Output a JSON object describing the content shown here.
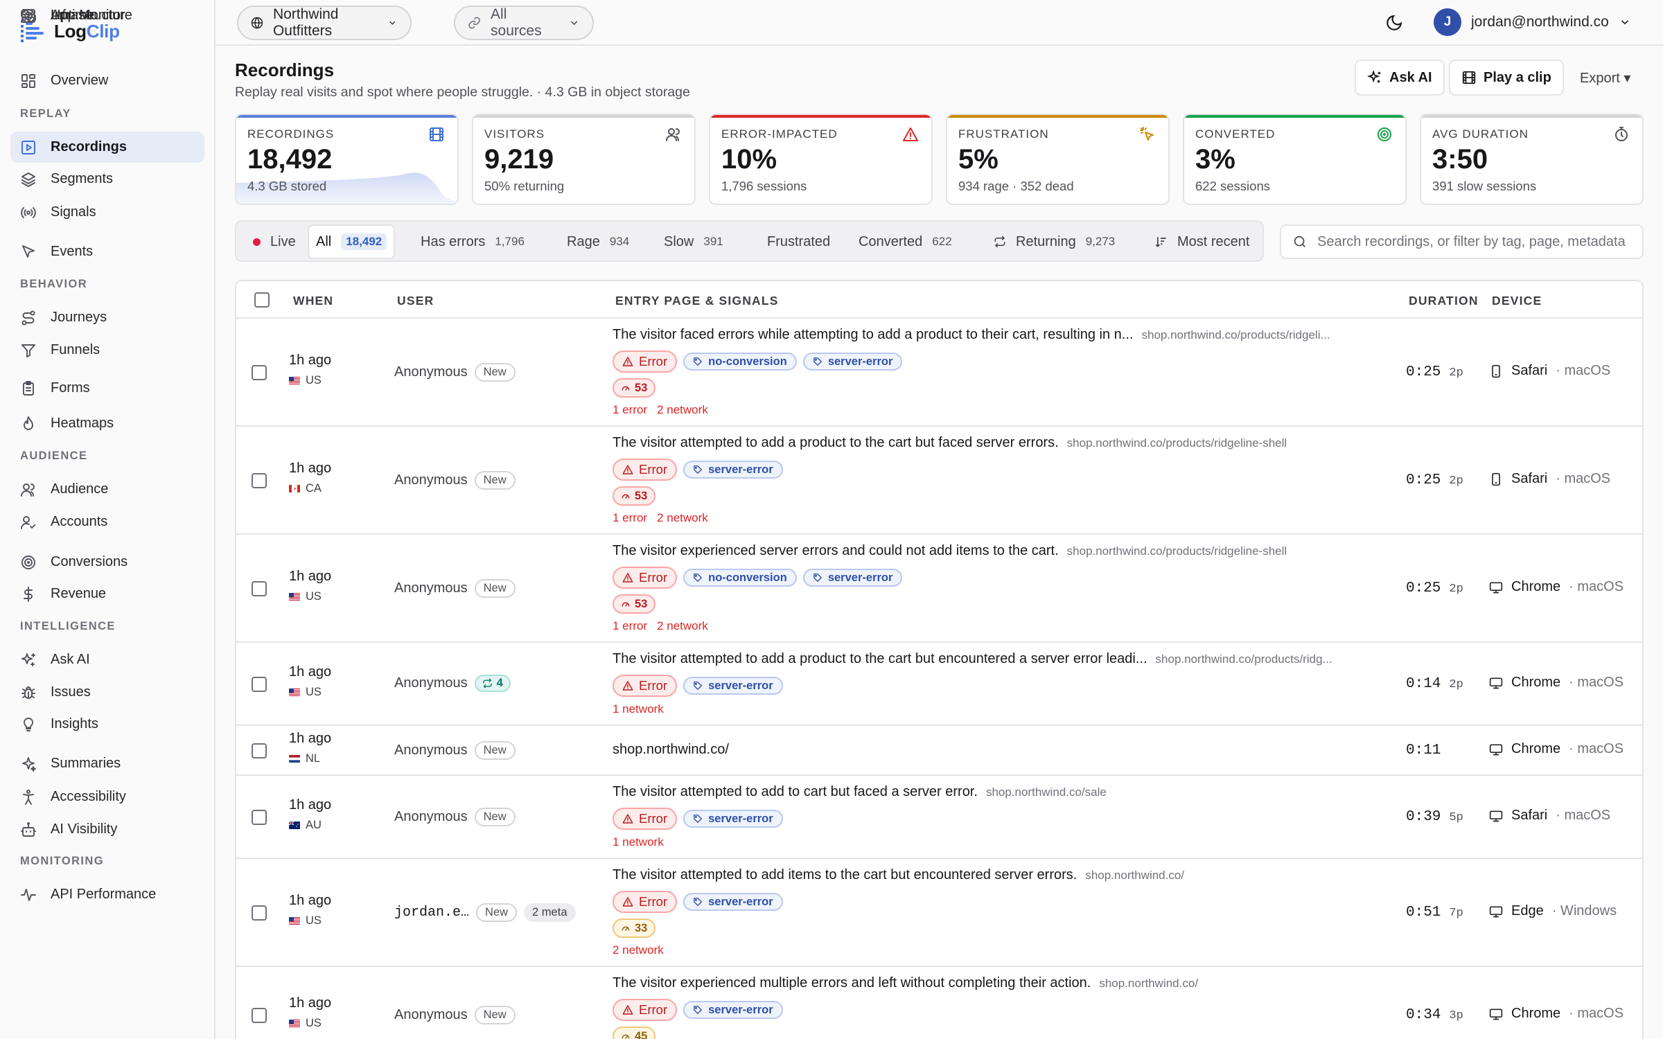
{
  "brand": {
    "name_a": "Log",
    "name_b": "Clip"
  },
  "colors": {
    "accent": "#3b6fd4",
    "error": "#dc2626",
    "success": "#16a34a",
    "warning": "#ca8a04"
  },
  "sidebar": {
    "top": [
      {
        "label": "Overview",
        "icon": "grid-icon"
      }
    ],
    "sections": [
      {
        "title": "REPLAY",
        "items": [
          {
            "label": "Recordings",
            "icon": "play-square-icon",
            "active": true
          },
          {
            "label": "Segments",
            "icon": "layers-icon"
          },
          {
            "label": "Signals",
            "icon": "broadcast-icon"
          },
          {
            "label": "Events",
            "icon": "cursor-icon"
          }
        ]
      },
      {
        "title": "BEHAVIOR",
        "items": [
          {
            "label": "Journeys",
            "icon": "route-icon"
          },
          {
            "label": "Funnels",
            "icon": "funnel-icon"
          },
          {
            "label": "Forms",
            "icon": "clipboard-icon"
          },
          {
            "label": "Heatmaps",
            "icon": "flame-icon"
          }
        ]
      },
      {
        "title": "AUDIENCE",
        "items": [
          {
            "label": "Audience",
            "icon": "users-icon"
          },
          {
            "label": "Accounts",
            "icon": "user-check-icon"
          },
          {
            "label": "Conversions",
            "icon": "target-icon"
          },
          {
            "label": "Revenue",
            "icon": "dollar-icon"
          }
        ]
      },
      {
        "title": "INTELLIGENCE",
        "items": [
          {
            "label": "Ask AI",
            "icon": "sparkles-icon"
          },
          {
            "label": "Issues",
            "icon": "bug-icon"
          },
          {
            "label": "Insights",
            "icon": "lightbulb-icon"
          },
          {
            "label": "Summaries",
            "icon": "sparkle-icon"
          },
          {
            "label": "Accessibility",
            "icon": "accessibility-icon"
          },
          {
            "label": "AI Visibility",
            "icon": "bot-icon"
          }
        ]
      },
      {
        "title": "MONITORING",
        "items": [
          {
            "label": "API Performance",
            "icon": "activity-icon"
          },
          {
            "label": "App Monitor",
            "icon": "boxes-icon"
          },
          {
            "label": "Uptime",
            "icon": "radar-icon"
          },
          {
            "label": "Infrastructure",
            "icon": "server-icon"
          }
        ]
      }
    ]
  },
  "topbar": {
    "workspace": "Northwind Outfitters",
    "sources": "All sources",
    "user_initial": "J",
    "user_email": "jordan@northwind.co"
  },
  "page": {
    "title": "Recordings",
    "subtitle": "Replay real visits and spot where people struggle. · 4.3 GB in object storage",
    "ask_ai": "Ask AI",
    "play_clip": "Play a clip",
    "export": "Export ▾"
  },
  "stats": [
    {
      "label": "RECORDINGS",
      "value": "18,492",
      "sub": "4.3 GB stored",
      "icon": "film-icon",
      "color": "#5b7fd9"
    },
    {
      "label": "VISITORS",
      "value": "9,219",
      "sub": "50% returning",
      "icon": "users-icon",
      "color": "#d4d4d8"
    },
    {
      "label": "ERROR-IMPACTED",
      "value": "10%",
      "sub": "1,796 sessions",
      "icon": "alert-triangle-icon",
      "color": "#dc2626"
    },
    {
      "label": "FRUSTRATION",
      "value": "5%",
      "sub": "934 rage · 352 dead",
      "icon": "click-burst-icon",
      "color": "#ca8a04"
    },
    {
      "label": "CONVERTED",
      "value": "3%",
      "sub": "622 sessions",
      "icon": "target-icon",
      "color": "#16a34a"
    },
    {
      "label": "AVG DURATION",
      "value": "3:50",
      "sub": "391 slow sessions",
      "icon": "timer-icon",
      "color": "#d4d4d8"
    }
  ],
  "filters": {
    "live": "Live",
    "items": [
      {
        "label": "All",
        "count": "18,492",
        "active": true
      },
      {
        "label": "Has errors",
        "count": "1,796"
      },
      {
        "label": "Rage",
        "count": "934"
      },
      {
        "label": "Slow",
        "count": "391"
      },
      {
        "label": "Frustrated",
        "count": ""
      },
      {
        "label": "Converted",
        "count": "622"
      },
      {
        "label": "Returning",
        "count": "9,273"
      }
    ],
    "sort": "Most recent",
    "search_placeholder": "Search recordings, or filter by tag, page, metadata"
  },
  "table": {
    "columns": {
      "when": "WHEN",
      "user": "USER",
      "entry": "ENTRY PAGE & SIGNALS",
      "duration": "DURATION",
      "device": "DEVICE"
    },
    "rows": [
      {
        "when": "1h ago",
        "country": "US",
        "user": "Anonymous",
        "badge": "New",
        "summary": "The visitor faced errors while attempting to add a product to their cart, resulting in n...",
        "url": "shop.northwind.co/products/ridgeli...",
        "tags": [
          "no-conversion",
          "server-error"
        ],
        "error_label": "Error",
        "score": "53",
        "score_level": "red",
        "errors": "1 error",
        "network": "2 network",
        "duration": "0:25",
        "pages": "2p",
        "browser": "Safari",
        "os": "· macOS",
        "device_type": "mobile"
      },
      {
        "when": "1h ago",
        "country": "CA",
        "user": "Anonymous",
        "badge": "New",
        "summary": "The visitor attempted to add a product to the cart but faced server errors.",
        "url": "shop.northwind.co/products/ridgeline-shell",
        "tags": [
          "server-error"
        ],
        "error_label": "Error",
        "score": "53",
        "score_level": "red",
        "errors": "1 error",
        "network": "2 network",
        "duration": "0:25",
        "pages": "2p",
        "browser": "Safari",
        "os": "· macOS",
        "device_type": "mobile"
      },
      {
        "when": "1h ago",
        "country": "US",
        "user": "Anonymous",
        "badge": "New",
        "summary": "The visitor experienced server errors and could not add items to the cart.",
        "url": "shop.northwind.co/products/ridgeline-shell",
        "tags": [
          "no-conversion",
          "server-error"
        ],
        "error_label": "Error",
        "score": "53",
        "score_level": "red",
        "errors": "1 error",
        "network": "2 network",
        "duration": "0:25",
        "pages": "2p",
        "browser": "Chrome",
        "os": "· macOS",
        "device_type": "desktop"
      },
      {
        "when": "1h ago",
        "country": "US",
        "user": "Anonymous",
        "returning": "4",
        "summary": "The visitor attempted to add a product to the cart but encountered a server error leadi...",
        "url": "shop.northwind.co/products/ridg...",
        "tags": [
          "server-error"
        ],
        "error_label": "Error",
        "network": "1 network",
        "duration": "0:14",
        "pages": "2p",
        "browser": "Chrome",
        "os": "· macOS",
        "device_type": "desktop"
      },
      {
        "when": "1h ago",
        "country": "NL",
        "user": "Anonymous",
        "badge": "New",
        "summary": "shop.northwind.co/",
        "duration": "0:11",
        "pages": "",
        "browser": "Chrome",
        "os": "· macOS",
        "device_type": "desktop"
      },
      {
        "when": "1h ago",
        "country": "AU",
        "user": "Anonymous",
        "badge": "New",
        "summary": "The visitor attempted to add to cart but faced a server error.",
        "url": "shop.northwind.co/sale",
        "tags": [
          "server-error"
        ],
        "error_label": "Error",
        "network": "1 network",
        "duration": "0:39",
        "pages": "5p",
        "browser": "Safari",
        "os": "· macOS",
        "device_type": "desktop"
      },
      {
        "when": "1h ago",
        "country": "US",
        "user": "jordan.e…",
        "user_mono": true,
        "badge": "New",
        "meta": "2 meta",
        "summary": "The visitor attempted to add items to the cart but encountered server errors.",
        "url": "shop.northwind.co/",
        "tags": [
          "server-error"
        ],
        "error_label": "Error",
        "score": "33",
        "score_level": "amber",
        "network": "2 network",
        "duration": "0:51",
        "pages": "7p",
        "browser": "Edge",
        "os": "· Windows",
        "device_type": "desktop"
      },
      {
        "when": "1h ago",
        "country": "US",
        "user": "Anonymous",
        "badge": "New",
        "summary": "The visitor experienced multiple errors and left without completing their action.",
        "url": "shop.northwind.co/",
        "tags": [
          "server-error"
        ],
        "error_label": "Error",
        "score": "45",
        "score_level": "amber",
        "duration": "0:34",
        "pages": "3p",
        "browser": "Chrome",
        "os": "· macOS",
        "device_type": "desktop"
      }
    ]
  }
}
